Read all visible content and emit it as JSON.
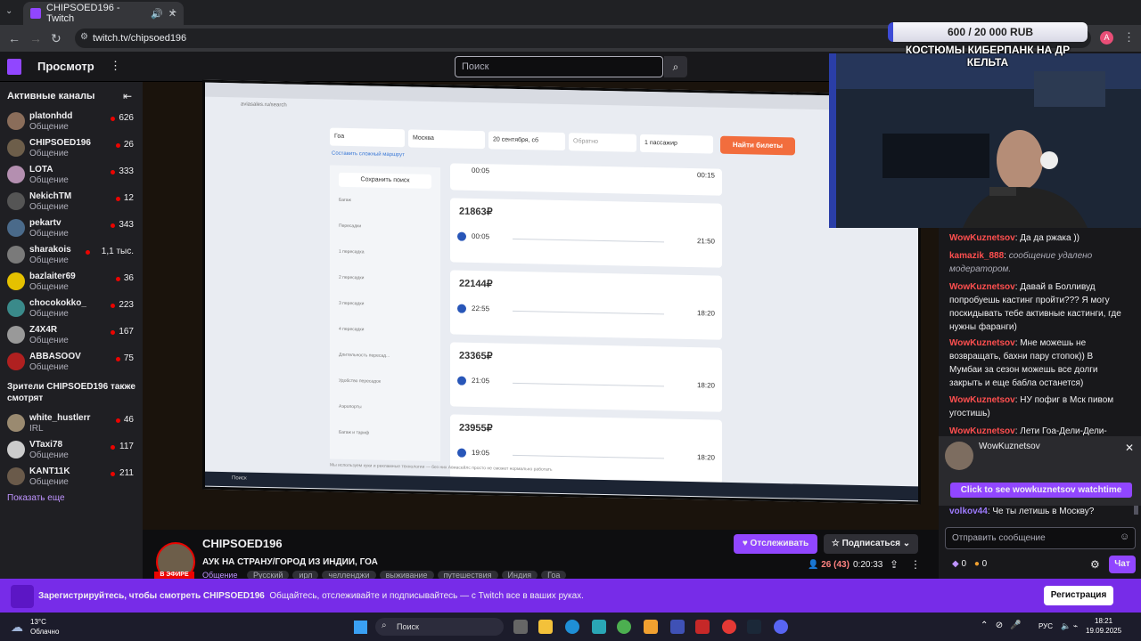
{
  "browser": {
    "tab_title": "CHIPSOED196 - Twitch",
    "url": "twitch.tv/chipsoed196",
    "profile_initial": "A"
  },
  "topnav": {
    "browse": "Просмотр",
    "search_placeholder": "Поиск"
  },
  "sidebar": {
    "heading": "Активные каналы",
    "channels": [
      {
        "name": "platonhdd",
        "category": "Общение",
        "viewers": "626",
        "color": "#8a6d5a"
      },
      {
        "name": "CHIPSOED196",
        "category": "Общение",
        "viewers": "26",
        "color": "#6d5e4a"
      },
      {
        "name": "LOTA",
        "category": "Общение",
        "viewers": "333",
        "color": "#b48fb0"
      },
      {
        "name": "NekichTM",
        "category": "Общение",
        "viewers": "12",
        "color": "#555"
      },
      {
        "name": "pekartv",
        "category": "Общение",
        "viewers": "343",
        "color": "#4a6a8a"
      },
      {
        "name": "sharakois",
        "category": "Общение",
        "viewers": "1,1 тыс.",
        "color": "#7a7a7a"
      },
      {
        "name": "bazlaiter69",
        "category": "Общение",
        "viewers": "36",
        "color": "#e5c100"
      },
      {
        "name": "chocokokko_",
        "category": "Общение",
        "viewers": "223",
        "color": "#3a8a8a"
      },
      {
        "name": "Z4X4R",
        "category": "Общение",
        "viewers": "167",
        "color": "#999"
      },
      {
        "name": "ABBASOOV",
        "category": "Общение",
        "viewers": "75",
        "color": "#b02020"
      }
    ],
    "also_heading": "Зрители CHIPSOED196 также смотрят",
    "also": [
      {
        "name": "white_hustlerr",
        "category": "IRL",
        "viewers": "46",
        "color": "#9a8a70"
      },
      {
        "name": "VTaxi78",
        "category": "Общение",
        "viewers": "117",
        "color": "#ccc"
      },
      {
        "name": "KANT11K",
        "category": "Общение",
        "viewers": "211",
        "color": "#6a5a4a"
      }
    ],
    "show_more": "Показать еще"
  },
  "overlay": {
    "donation": "600 / 20 000 RUB",
    "donation_title": "КОСТЮМЫ КИБЕРПАНК НА ДР КЕЛЬТА",
    "donation_progress": 0.03
  },
  "screen": {
    "from": "Гоа",
    "to": "Москва",
    "date": "20 сентября, сб",
    "return": "Обратно",
    "passengers": "1 пассажир",
    "find": "Найти билеты",
    "complex_route": "Составить сложный маршрут",
    "save_search": "Сохранить поиск",
    "filters": [
      "Багаж",
      "Пересадки",
      "1 пересадка",
      "2 пересадки",
      "3 пересадки",
      "4 пересадки",
      "Длительность пересад...",
      "Удобство пересадок",
      "Аэропорты",
      "Багаж и тариф"
    ],
    "cards": [
      {
        "price": "21863₽",
        "dep": "00:05",
        "arr": "21:50"
      },
      {
        "price": "22144₽",
        "dep": "22:55",
        "arr": "18:20"
      },
      {
        "price": "23365₽",
        "dep": "21:05",
        "arr": "18:20"
      },
      {
        "price": "23955₽",
        "dep": "19:05",
        "arr": "18:20"
      }
    ],
    "top_card": {
      "dep": "00:05",
      "arr": "00:15"
    },
    "footer": "Мы используем куки и рекламные технологии — без них Авиасейлс просто не сможет нормально работать",
    "win_search": "Поиск"
  },
  "stream": {
    "channel": "CHIPSOED196",
    "live_label": "В ЭФИРЕ",
    "title": "АУК НА СТРАНУ/ГОРОД ИЗ ИНДИИ, ГОА",
    "category": "Общение",
    "tags": [
      "Русский",
      "ирл",
      "челленджи",
      "выживание",
      "путешествия",
      "Индия",
      "Гоа"
    ],
    "follow": "Отслеживать",
    "subscribe": "Подписаться",
    "viewers": "26 (43)",
    "uptime": "0:20:33"
  },
  "chat": {
    "messages": [
      {
        "user": "WowKuznetsov",
        "color": "#ff4f4f",
        "text": "Да да ржака ))"
      },
      {
        "user": "kamazik_888",
        "color": "#ff4f4f",
        "text": "сообщение удалено модератором.",
        "deleted": true
      },
      {
        "user": "WowKuznetsov",
        "color": "#ff4f4f",
        "text": "Давай в Болливуд попробуешь кастинг пройти??? Я могу поскидывать тебе активные кастинги, где нужны фаранги)"
      },
      {
        "user": "WowKuznetsov",
        "color": "#ff4f4f",
        "text": "Мне можешь не возвращать, бахни пару стопок)) В Мумбаи за сезон можешь все долги закрыть и еще бабла останется)"
      },
      {
        "user": "WowKuznetsov",
        "color": "#ff4f4f",
        "text": "НУ пофиг в Мск пивом угостишь)"
      },
      {
        "user": "WowKuznetsov",
        "color": "#ff4f4f",
        "text": "Лети Гоа-Дели-Дели-"
      }
    ],
    "popup_user": "WowKuznetsov",
    "popup_button": "Click to see wowkuznetsov watchtime",
    "last_message": {
      "user": "volkov44",
      "color": "#9e7bff",
      "text": "Че ты летишь в Москву?"
    },
    "input_placeholder": "Отправить сообщение",
    "points": "0",
    "points2": "0",
    "chat_button": "Чат"
  },
  "banner": {
    "text_bold": "Зарегистрируйтесь, чтобы смотреть CHIPSOED196",
    "text": "Общайтесь, отслеживайте и подписывайтесь — с Twitch все в ваших руках.",
    "register": "Регистрация"
  },
  "taskbar": {
    "temp": "13°C",
    "weather": "Облачно",
    "search": "Поиск",
    "lang": "РУС",
    "time": "18:21",
    "date": "19.09.2025"
  }
}
